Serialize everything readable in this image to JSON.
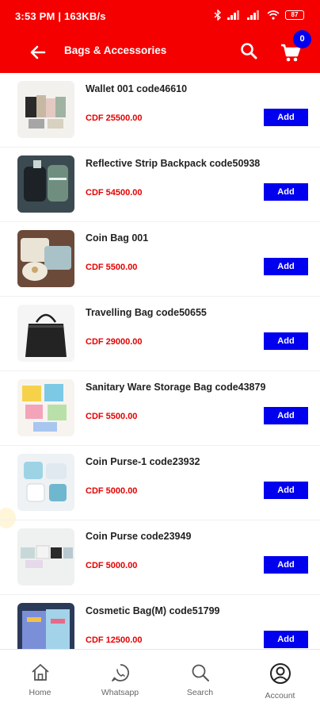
{
  "status_bar": {
    "time": "3:53 PM | 163KB/s",
    "battery": "87"
  },
  "header": {
    "title": "Bags & Accessories",
    "cart_count": "0"
  },
  "colors": {
    "brand": "#f40000",
    "button": "#0000ee",
    "price": "#e60000"
  },
  "products": [
    {
      "name": "Wallet 001 code46610",
      "price": "CDF 25500.00",
      "add_label": "Add"
    },
    {
      "name": "Reflective Strip Backpack code50938",
      "price": "CDF 54500.00",
      "add_label": "Add"
    },
    {
      "name": "Coin Bag 001",
      "price": "CDF 5500.00",
      "add_label": "Add"
    },
    {
      "name": "Travelling Bag code50655",
      "price": "CDF 29000.00",
      "add_label": "Add"
    },
    {
      "name": "Sanitary Ware Storage Bag code43879",
      "price": "CDF 5500.00",
      "add_label": "Add"
    },
    {
      "name": "Coin Purse-1 code23932",
      "price": "CDF 5000.00",
      "add_label": "Add"
    },
    {
      "name": "Coin Purse code23949",
      "price": "CDF 5000.00",
      "add_label": "Add"
    },
    {
      "name": "Cosmetic Bag(M) code51799",
      "price": "CDF 12500.00",
      "add_label": "Add"
    }
  ],
  "bottom_nav": [
    {
      "label": "Home",
      "icon": "home-icon"
    },
    {
      "label": "Whatsapp",
      "icon": "whatsapp-icon"
    },
    {
      "label": "Search",
      "icon": "search-icon"
    },
    {
      "label": "Account",
      "icon": "account-icon"
    }
  ]
}
